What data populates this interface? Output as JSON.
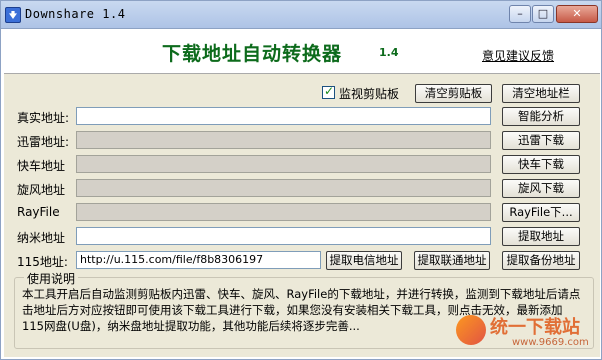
{
  "window": {
    "title": "Downshare 1.4",
    "controls": {
      "minimize": "–",
      "maximize": "□",
      "close": "✕"
    }
  },
  "banner": {
    "title": "下载地址自动转换器",
    "version": "1.4",
    "feedback_link": "意见建议反馈"
  },
  "clipboard": {
    "monitor_label": "监视剪贴板",
    "monitor_checked": true,
    "clear_clipboard_button": "清空剪贴板",
    "clear_address_bar_button": "清空地址栏"
  },
  "rows": [
    {
      "label": "真实地址:",
      "value": "",
      "enabled": true,
      "button": "智能分析"
    },
    {
      "label": "迅雷地址:",
      "value": "",
      "enabled": false,
      "button": "迅雷下载"
    },
    {
      "label": "快车地址",
      "value": "",
      "enabled": false,
      "button": "快车下载"
    },
    {
      "label": "旋风地址",
      "value": "",
      "enabled": false,
      "button": "旋风下载"
    },
    {
      "label": "RayFile",
      "value": "",
      "enabled": false,
      "button": "RayFile下..."
    },
    {
      "label": "纳米地址",
      "value": "",
      "enabled": true,
      "button": "提取地址"
    }
  ],
  "row115": {
    "label": "115地址:",
    "value": "http://u.115.com/file/f8b8306197",
    "buttons": [
      "提取电信地址",
      "提取联通地址",
      "提取备份地址"
    ]
  },
  "usage": {
    "legend": "使用说明",
    "text": "本工具开启后自动监测剪贴板内迅雷、快车、旋风、RayFile的下载地址，并进行转换，监测到下载地址后请点击地址后方对应按钮即可使用该下载工具进行下载，如果您没有安装相关下载工具，则点击无效，最新添加115网盘(U盘)，纳米盘地址提取功能，其他功能后续将逐步完善..."
  },
  "watermark": {
    "text": "统一下载站",
    "site": "www.9669.com"
  }
}
